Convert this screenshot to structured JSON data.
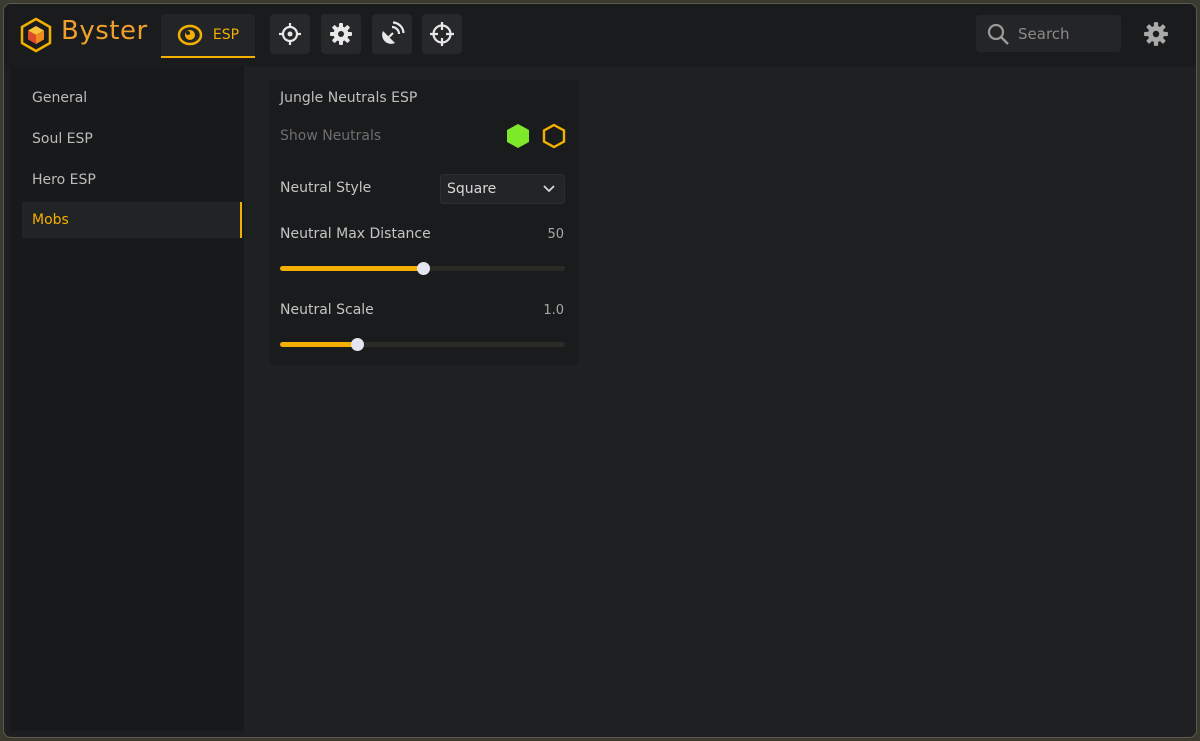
{
  "app": {
    "brand": "Byster",
    "accent_color": "#f4b000",
    "logo_icon": "hexagon-cube-logo"
  },
  "topbar": {
    "tabs": [
      {
        "label": "ESP",
        "icon": "eye-icon",
        "active": true
      },
      {
        "label": "",
        "icon": "crosshair-circle-icon"
      },
      {
        "label": "",
        "icon": "gear-icon"
      },
      {
        "label": "",
        "icon": "satellite-signal-icon"
      },
      {
        "label": "",
        "icon": "target-icon"
      }
    ],
    "search": {
      "placeholder": "Search",
      "value": ""
    },
    "settings_icon": "gear-icon"
  },
  "sidebar": {
    "items": [
      {
        "label": "General",
        "active": false
      },
      {
        "label": "Soul ESP",
        "active": false
      },
      {
        "label": "Hero ESP",
        "active": false
      },
      {
        "label": "Mobs",
        "active": true
      }
    ]
  },
  "panel": {
    "title": "Jungle Neutrals ESP",
    "show_neutrals": {
      "label": "Show Neutrals",
      "color_filled": "#7ee92b",
      "color_outline": "#f4b000"
    },
    "style": {
      "label": "Neutral Style",
      "value": "Square"
    },
    "max_distance": {
      "label": "Neutral Max Distance",
      "value": "50",
      "fraction": 0.5
    },
    "scale": {
      "label": "Neutral Scale",
      "value": "1.0",
      "fraction": 0.27
    }
  }
}
